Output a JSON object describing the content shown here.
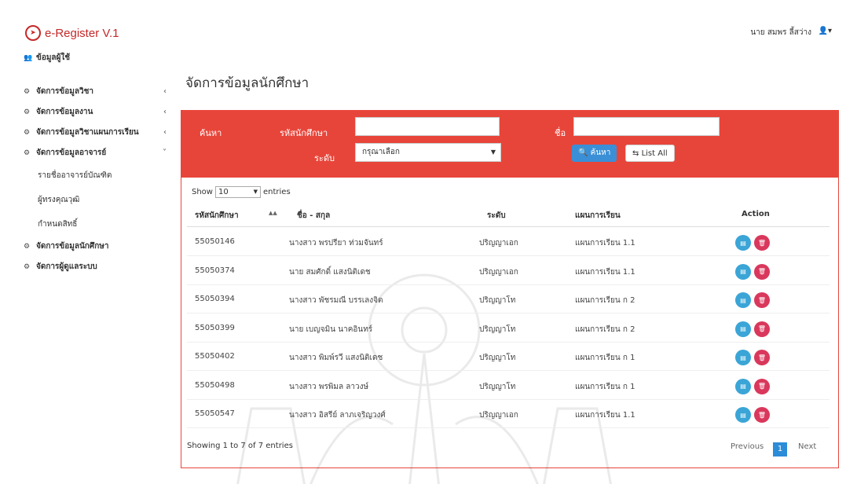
{
  "app": {
    "title": "e-Register V.1",
    "logo_icon": "paper-plane-icon"
  },
  "user": {
    "name": "นาย สมพร ลี้สว่าง",
    "menu_icon": "user-icon"
  },
  "sidebar": {
    "items": [
      {
        "label": "ข้อมูลผู้ใช้",
        "icon": "users-icon",
        "chevron": ""
      },
      {
        "label": "จัดการข้อมูลวิชา",
        "icon": "cogs-icon",
        "chevron": "‹"
      },
      {
        "label": "จัดการข้อมูลงาน",
        "icon": "cogs-icon",
        "chevron": "‹"
      },
      {
        "label": "จัดการข้อมูลวิชาแผนการเรียน",
        "icon": "cogs-icon",
        "chevron": "‹"
      },
      {
        "label": "จัดการข้อมูลอาจารย์",
        "icon": "cogs-icon",
        "chevron": "˅"
      }
    ],
    "subitems": [
      {
        "label": "รายชื่ออาจารย์บัณฑิต"
      },
      {
        "label": "ผู้ทรงคุณวุฒิ"
      },
      {
        "label": "กำหนดสิทธิ์"
      }
    ],
    "items_after": [
      {
        "label": "จัดการข้อมูลนักศึกษา",
        "icon": "cogs-icon"
      },
      {
        "label": "จัดการผู้ดูแลระบบ",
        "icon": "cogs-icon"
      }
    ]
  },
  "page": {
    "title": "จัดการข้อมูลนักศึกษา"
  },
  "search": {
    "section_label": "ค้นหา",
    "student_id_label": "รหัสนักศึกษา",
    "student_id_value": "",
    "name_label": "ชื่อ",
    "name_value": "",
    "level_label": "ระดับ",
    "level_selected": "กรุณาเลือก",
    "search_button": "ค้นหา",
    "list_all_button": "List All"
  },
  "table": {
    "show_label": "Show",
    "page_size": "10",
    "entries_label": "entries",
    "headers": [
      "รหัสนักศึกษา",
      "ชื่อ - สกุล",
      "ระดับ",
      "แผนการเรียน",
      "Action"
    ],
    "rows": [
      {
        "id": "55050146",
        "name": "นางสาว พรปรียา ท่วมจันทร์",
        "level": "ปริญญาเอก",
        "plan": "แผนการเรียน 1.1"
      },
      {
        "id": "55050374",
        "name": "นาย สมศักดิ์ แสงนิติเดช",
        "level": "ปริญญาเอก",
        "plan": "แผนการเรียน 1.1"
      },
      {
        "id": "55050394",
        "name": "นางสาว พัชรมณี บรรเลงจิต",
        "level": "ปริญญาโท",
        "plan": "แผนการเรียน ก 2"
      },
      {
        "id": "55050399",
        "name": "นาย เบญจมิน นาคอินทร์",
        "level": "ปริญญาโท",
        "plan": "แผนการเรียน ก 2"
      },
      {
        "id": "55050402",
        "name": "นางสาว พิมพ์รวี แสงนิติเดช",
        "level": "ปริญญาโท",
        "plan": "แผนการเรียน ก 1"
      },
      {
        "id": "55050498",
        "name": "นางสาว พรพิมล ลาวงษ์",
        "level": "ปริญญาโท",
        "plan": "แผนการเรียน ก 1"
      },
      {
        "id": "55050547",
        "name": "นางสาว อิสรีย์ ลาภเจริญวงศ์",
        "level": "ปริญญาเอก",
        "plan": "แผนการเรียน 1.1"
      }
    ],
    "info": "Showing 1 to 7 of 7 entries",
    "prev_label": "Previous",
    "current_page": "1",
    "next_label": "Next"
  },
  "colors": {
    "accent": "#e8453a",
    "primary": "#2c8cd8",
    "edit": "#3aa5d6",
    "delete": "#d9385c",
    "brand": "#c62828"
  }
}
